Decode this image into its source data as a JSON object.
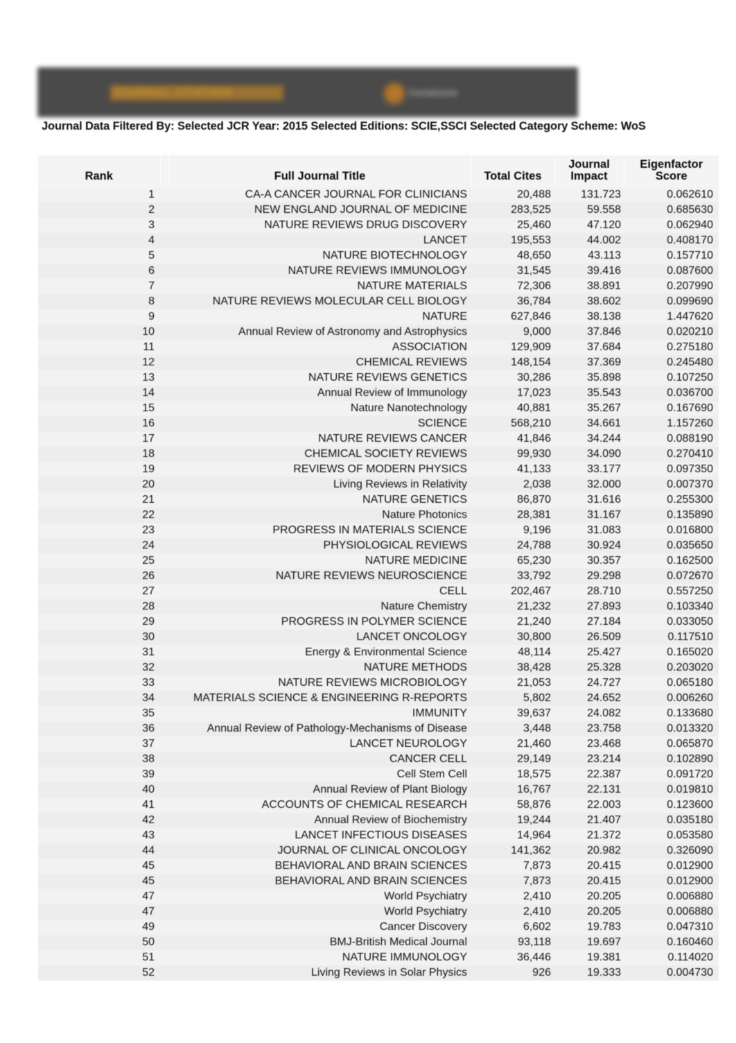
{
  "banner": {
    "background_color": "#4a4a4a",
    "logo_text": "JOURNAL CITATION",
    "logo_color": "#c08c32",
    "right_label": "THOMSON",
    "right_dot_color": "#b4762a"
  },
  "filter": {
    "text": "Journal Data Filtered By:  Selected JCR Year: 2015 Selected Editions: SCIE,SSCI Selected Category Scheme: WoS"
  },
  "table": {
    "headers": {
      "rank": "Rank",
      "title": "Full Journal Title",
      "cites": "Total Cites",
      "impact_line1": "Journal",
      "impact_line2": "Impact",
      "eigen_line1": "Eigenfactor",
      "eigen_line2": "Score"
    },
    "rows": [
      {
        "rank": "1",
        "title": "CA-A CANCER JOURNAL FOR CLINICIANS",
        "cites": "20,488",
        "impact": "131.723",
        "eigen": "0.062610"
      },
      {
        "rank": "2",
        "title": "NEW ENGLAND JOURNAL OF MEDICINE",
        "cites": "283,525",
        "impact": "59.558",
        "eigen": "0.685630"
      },
      {
        "rank": "3",
        "title": "NATURE REVIEWS DRUG DISCOVERY",
        "cites": "25,460",
        "impact": "47.120",
        "eigen": "0.062940"
      },
      {
        "rank": "4",
        "title": "LANCET",
        "cites": "195,553",
        "impact": "44.002",
        "eigen": "0.408170"
      },
      {
        "rank": "5",
        "title": "NATURE BIOTECHNOLOGY",
        "cites": "48,650",
        "impact": "43.113",
        "eigen": "0.157710"
      },
      {
        "rank": "6",
        "title": "NATURE REVIEWS IMMUNOLOGY",
        "cites": "31,545",
        "impact": "39.416",
        "eigen": "0.087600"
      },
      {
        "rank": "7",
        "title": "NATURE MATERIALS",
        "cites": "72,306",
        "impact": "38.891",
        "eigen": "0.207990"
      },
      {
        "rank": "8",
        "title": "NATURE REVIEWS MOLECULAR CELL BIOLOGY",
        "cites": "36,784",
        "impact": "38.602",
        "eigen": "0.099690"
      },
      {
        "rank": "9",
        "title": "NATURE",
        "cites": "627,846",
        "impact": "38.138",
        "eigen": "1.447620"
      },
      {
        "rank": "10",
        "title": "Annual Review of Astronomy and Astrophysics",
        "cites": "9,000",
        "impact": "37.846",
        "eigen": "0.020210"
      },
      {
        "rank": "11",
        "title": "ASSOCIATION",
        "cites": "129,909",
        "impact": "37.684",
        "eigen": "0.275180"
      },
      {
        "rank": "12",
        "title": "CHEMICAL REVIEWS",
        "cites": "148,154",
        "impact": "37.369",
        "eigen": "0.245480"
      },
      {
        "rank": "13",
        "title": "NATURE REVIEWS GENETICS",
        "cites": "30,286",
        "impact": "35.898",
        "eigen": "0.107250"
      },
      {
        "rank": "14",
        "title": "Annual Review of Immunology",
        "cites": "17,023",
        "impact": "35.543",
        "eigen": "0.036700"
      },
      {
        "rank": "15",
        "title": "Nature Nanotechnology",
        "cites": "40,881",
        "impact": "35.267",
        "eigen": "0.167690"
      },
      {
        "rank": "16",
        "title": "SCIENCE",
        "cites": "568,210",
        "impact": "34.661",
        "eigen": "1.157260"
      },
      {
        "rank": "17",
        "title": "NATURE REVIEWS CANCER",
        "cites": "41,846",
        "impact": "34.244",
        "eigen": "0.088190"
      },
      {
        "rank": "18",
        "title": "CHEMICAL SOCIETY REVIEWS",
        "cites": "99,930",
        "impact": "34.090",
        "eigen": "0.270410"
      },
      {
        "rank": "19",
        "title": "REVIEWS OF MODERN PHYSICS",
        "cites": "41,133",
        "impact": "33.177",
        "eigen": "0.097350"
      },
      {
        "rank": "20",
        "title": "Living Reviews in Relativity",
        "cites": "2,038",
        "impact": "32.000",
        "eigen": "0.007370"
      },
      {
        "rank": "21",
        "title": "NATURE GENETICS",
        "cites": "86,870",
        "impact": "31.616",
        "eigen": "0.255300"
      },
      {
        "rank": "22",
        "title": "Nature Photonics",
        "cites": "28,381",
        "impact": "31.167",
        "eigen": "0.135890"
      },
      {
        "rank": "23",
        "title": "PROGRESS IN MATERIALS SCIENCE",
        "cites": "9,196",
        "impact": "31.083",
        "eigen": "0.016800"
      },
      {
        "rank": "24",
        "title": "PHYSIOLOGICAL REVIEWS",
        "cites": "24,788",
        "impact": "30.924",
        "eigen": "0.035650"
      },
      {
        "rank": "25",
        "title": "NATURE MEDICINE",
        "cites": "65,230",
        "impact": "30.357",
        "eigen": "0.162500"
      },
      {
        "rank": "26",
        "title": "NATURE REVIEWS NEUROSCIENCE",
        "cites": "33,792",
        "impact": "29.298",
        "eigen": "0.072670"
      },
      {
        "rank": "27",
        "title": "CELL",
        "cites": "202,467",
        "impact": "28.710",
        "eigen": "0.557250"
      },
      {
        "rank": "28",
        "title": "Nature Chemistry",
        "cites": "21,232",
        "impact": "27.893",
        "eigen": "0.103340"
      },
      {
        "rank": "29",
        "title": "PROGRESS IN POLYMER SCIENCE",
        "cites": "21,240",
        "impact": "27.184",
        "eigen": "0.033050"
      },
      {
        "rank": "30",
        "title": "LANCET ONCOLOGY",
        "cites": "30,800",
        "impact": "26.509",
        "eigen": "0.117510"
      },
      {
        "rank": "31",
        "title": "Energy & Environmental Science",
        "cites": "48,114",
        "impact": "25.427",
        "eigen": "0.165020"
      },
      {
        "rank": "32",
        "title": "NATURE METHODS",
        "cites": "38,428",
        "impact": "25.328",
        "eigen": "0.203020"
      },
      {
        "rank": "33",
        "title": "NATURE REVIEWS MICROBIOLOGY",
        "cites": "21,053",
        "impact": "24.727",
        "eigen": "0.065180"
      },
      {
        "rank": "34",
        "title": "MATERIALS SCIENCE & ENGINEERING R-REPORTS",
        "cites": "5,802",
        "impact": "24.652",
        "eigen": "0.006260"
      },
      {
        "rank": "35",
        "title": "IMMUNITY",
        "cites": "39,637",
        "impact": "24.082",
        "eigen": "0.133680"
      },
      {
        "rank": "36",
        "title": "Annual Review of Pathology-Mechanisms of Disease",
        "cites": "3,448",
        "impact": "23.758",
        "eigen": "0.013320"
      },
      {
        "rank": "37",
        "title": "LANCET NEUROLOGY",
        "cites": "21,460",
        "impact": "23.468",
        "eigen": "0.065870"
      },
      {
        "rank": "38",
        "title": "CANCER CELL",
        "cites": "29,149",
        "impact": "23.214",
        "eigen": "0.102890"
      },
      {
        "rank": "39",
        "title": "Cell Stem Cell",
        "cites": "18,575",
        "impact": "22.387",
        "eigen": "0.091720"
      },
      {
        "rank": "40",
        "title": "Annual Review of Plant Biology",
        "cites": "16,767",
        "impact": "22.131",
        "eigen": "0.019810"
      },
      {
        "rank": "41",
        "title": "ACCOUNTS OF CHEMICAL RESEARCH",
        "cites": "58,876",
        "impact": "22.003",
        "eigen": "0.123600"
      },
      {
        "rank": "42",
        "title": "Annual Review of Biochemistry",
        "cites": "19,244",
        "impact": "21.407",
        "eigen": "0.035180"
      },
      {
        "rank": "43",
        "title": "LANCET INFECTIOUS DISEASES",
        "cites": "14,964",
        "impact": "21.372",
        "eigen": "0.053580"
      },
      {
        "rank": "44",
        "title": "JOURNAL OF CLINICAL ONCOLOGY",
        "cites": "141,362",
        "impact": "20.982",
        "eigen": "0.326090"
      },
      {
        "rank": "45",
        "title": "BEHAVIORAL AND BRAIN SCIENCES",
        "cites": "7,873",
        "impact": "20.415",
        "eigen": "0.012900"
      },
      {
        "rank": "45",
        "title": "BEHAVIORAL AND BRAIN SCIENCES",
        "cites": "7,873",
        "impact": "20.415",
        "eigen": "0.012900"
      },
      {
        "rank": "47",
        "title": "World Psychiatry",
        "cites": "2,410",
        "impact": "20.205",
        "eigen": "0.006880"
      },
      {
        "rank": "47",
        "title": "World Psychiatry",
        "cites": "2,410",
        "impact": "20.205",
        "eigen": "0.006880"
      },
      {
        "rank": "49",
        "title": "Cancer Discovery",
        "cites": "6,602",
        "impact": "19.783",
        "eigen": "0.047310"
      },
      {
        "rank": "50",
        "title": "BMJ-British Medical Journal",
        "cites": "93,118",
        "impact": "19.697",
        "eigen": "0.160460"
      },
      {
        "rank": "51",
        "title": "NATURE IMMUNOLOGY",
        "cites": "36,446",
        "impact": "19.381",
        "eigen": "0.114020"
      },
      {
        "rank": "52",
        "title": "Living Reviews in Solar Physics",
        "cites": "926",
        "impact": "19.333",
        "eigen": "0.004730"
      }
    ]
  }
}
